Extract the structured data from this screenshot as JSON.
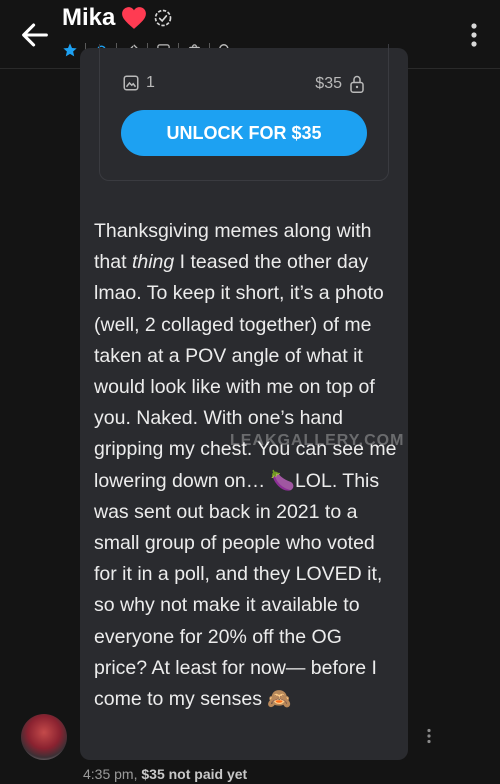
{
  "header": {
    "name": "Mika",
    "icons": [
      "back-arrow-icon",
      "heart-icon",
      "verified-icon",
      "star-icon",
      "bell-icon",
      "pin-icon",
      "image-icon",
      "shopping-bag-icon",
      "search-icon",
      "more-vert-icon"
    ]
  },
  "post": {
    "media_count": "1",
    "price": "$35",
    "unlock_label": "UNLOCK FOR $35",
    "text_parts": {
      "p1": "Thanksgiving memes along with that ",
      "p2": "thing",
      "p3": " I teased the other day lmao. To keep it short, it’s a photo (well, 2 collaged together) of me taken at a POV angle of what it would look like with me on top of you. Naked. With one’s hand gripping my chest. You can see me lowering down on… 🍆LOL. This was sent out back in 2021 to a small group of people who voted for it in a poll, and they LOVED it, so why not make it available to everyone for 20% off the OG price? At least for now— before I come to my senses 🙈"
    },
    "watermark": "LEAKGALLERY.COM"
  },
  "footer": {
    "time": "4:35 pm,",
    "status": "$35 not paid yet"
  },
  "colors": {
    "accent": "#1da1f2",
    "heart": "#ff3b52",
    "bubble": "#2a2b2f",
    "background": "#141414"
  }
}
